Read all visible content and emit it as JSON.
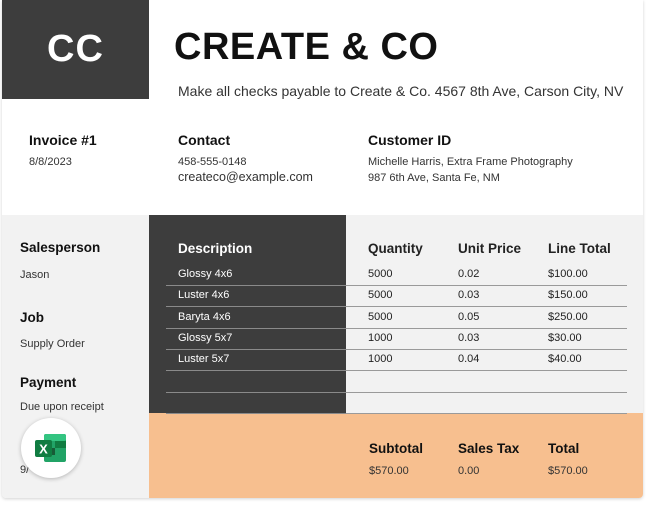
{
  "logo": {
    "initials": "CC"
  },
  "company": {
    "name": "CREATE & CO",
    "tagline": "Make all checks payable to Create & Co. 4567 8th Ave, Carson City, NV"
  },
  "invoice": {
    "label": "Invoice #1",
    "date": "8/8/2023"
  },
  "contact": {
    "label": "Contact",
    "phone": "458-555-0148",
    "email": "createco@example.com"
  },
  "customer": {
    "label": "Customer ID",
    "name": "Michelle Harris, Extra Frame Photography",
    "address": "987 6th Ave, Santa Fe, NM"
  },
  "sidebar": {
    "salesperson_label": "Salesperson",
    "salesperson_value": "Jason",
    "job_label": "Job",
    "job_value": "Supply Order",
    "payment_label": "Payment",
    "payment_value": "Due upon receipt",
    "partial_text": "9/"
  },
  "table": {
    "headers": {
      "description": "Description",
      "quantity": "Quantity",
      "unit_price": "Unit Price",
      "line_total": "Line Total"
    },
    "rows": [
      {
        "description": "Glossy 4x6",
        "quantity": "5000",
        "unit_price": "0.02",
        "line_total": "$100.00"
      },
      {
        "description": "Luster 4x6",
        "quantity": "5000",
        "unit_price": "0.03",
        "line_total": "$150.00"
      },
      {
        "description": "Baryta 4x6",
        "quantity": "5000",
        "unit_price": "0.05",
        "line_total": "$250.00"
      },
      {
        "description": "Glossy 5x7",
        "quantity": "1000",
        "unit_price": "0.03",
        "line_total": "$30.00"
      },
      {
        "description": "Luster 5x7",
        "quantity": "1000",
        "unit_price": "0.04",
        "line_total": "$40.00"
      }
    ]
  },
  "totals": {
    "subtotal_label": "Subtotal",
    "subtotal_value": "$570.00",
    "tax_label": "Sales Tax",
    "tax_value": "0.00",
    "total_label": "Total",
    "total_value": "$570.00"
  },
  "badge": {
    "icon": "excel-icon",
    "letter": "X"
  },
  "colors": {
    "dark": "#3d3d3d",
    "light": "#f2f2f2",
    "orange": "#f7bf8f",
    "excel_green": "#1d7a45"
  }
}
